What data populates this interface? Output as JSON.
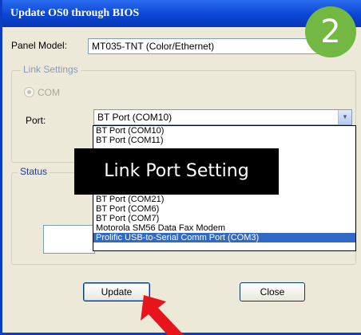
{
  "window": {
    "title": "Update OS0 through BIOS"
  },
  "panel_model": {
    "label": "Panel Model:",
    "value": "MT035-TNT (Color/Ethernet)"
  },
  "link_settings": {
    "title": "Link Settings",
    "com_option": "COM",
    "port_label": "Port:",
    "port_value": "BT Port (COM10)"
  },
  "port_dropdown": {
    "items": [
      "BT Port (COM10)",
      "BT Port (COM11)",
      "BT Port (COM21)",
      "BT Port (COM6)",
      "BT Port (COM7)",
      "Motorola SM56 Data Fax Modem",
      "Prolific USB-to-Serial Comm Port (COM3)"
    ],
    "selected_index": 6
  },
  "status": {
    "title": "Status"
  },
  "buttons": {
    "update": "Update",
    "close": "Close"
  },
  "annotation": {
    "caption": "Link Port Setting",
    "step_number": "2",
    "badge_color": "#72b842",
    "arrow_color": "#e8141c"
  }
}
